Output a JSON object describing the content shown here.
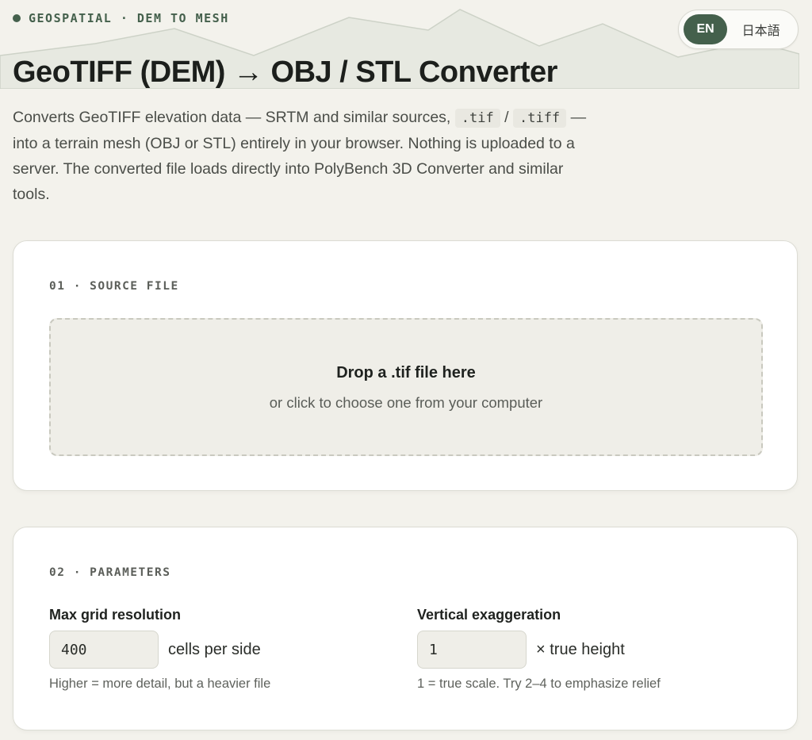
{
  "header": {
    "eyebrow": "GEOSPATIAL · DEM TO MESH",
    "title": "GeoTIFF (DEM) → OBJ / STL Converter",
    "intro": {
      "part1": "Converts GeoTIFF elevation data — SRTM and similar sources, ",
      "ext_tif": ".tif",
      "slash": " / ",
      "ext_tiff": ".tiff",
      "part2": " — into a terrain mesh (OBJ or STL) entirely in your browser. Nothing is uploaded to a server. The converted file loads directly into PolyBench 3D Converter and similar tools."
    }
  },
  "language_toggle": {
    "options": [
      "EN",
      "日本語"
    ],
    "selected": "EN"
  },
  "source_section": {
    "label": "01 · SOURCE FILE",
    "dropzone_title": "Drop a .tif file here",
    "dropzone_subtitle": "or click to choose one from your computer"
  },
  "parameters_section": {
    "label": "02 · PARAMETERS",
    "grid_resolution": {
      "label": "Max grid resolution",
      "value": "400",
      "unit": "cells per side",
      "hint": "Higher = more detail, but a heavier file"
    },
    "vertical_exaggeration": {
      "label": "Vertical exaggeration",
      "value": "1",
      "unit": "× true height",
      "hint": "1 = true scale. Try 2–4 to emphasize relief"
    }
  },
  "colors": {
    "accent": "#44604c",
    "background": "#f3f2ec",
    "card": "#ffffff",
    "mountain_fill": "#e6e8e0"
  }
}
